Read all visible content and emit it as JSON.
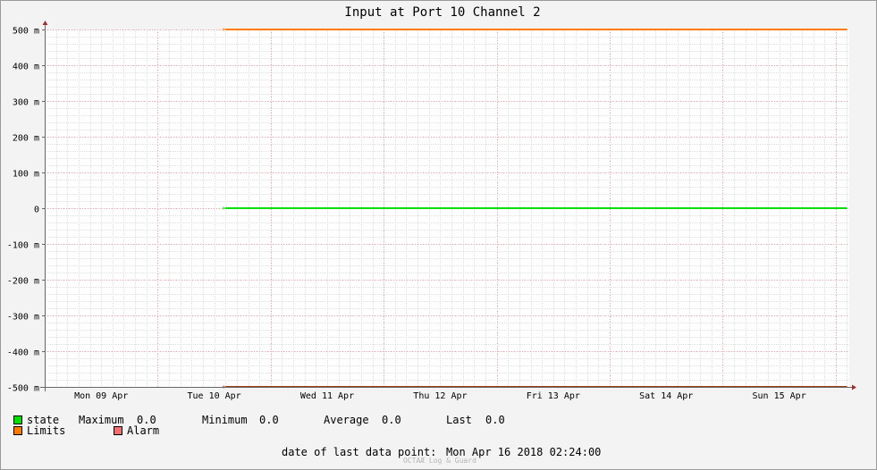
{
  "chart_data": {
    "type": "line",
    "title": "Input at Port 10 Channel 2",
    "ylim": [
      -500,
      500
    ],
    "y_ticks": [
      {
        "value": 500,
        "label": "500 m"
      },
      {
        "value": 400,
        "label": "400 m"
      },
      {
        "value": 300,
        "label": "300 m"
      },
      {
        "value": 200,
        "label": "200 m"
      },
      {
        "value": 100,
        "label": "100 m"
      },
      {
        "value": 0,
        "label": "0"
      },
      {
        "value": -100,
        "label": "-100 m"
      },
      {
        "value": -200,
        "label": "-200 m"
      },
      {
        "value": -300,
        "label": "-300 m"
      },
      {
        "value": -400,
        "label": "-400 m"
      },
      {
        "value": -500,
        "label": "-500 m"
      }
    ],
    "x_range_days": [
      0,
      7.12
    ],
    "x_ticks": [
      {
        "day": 0.5,
        "label": "Mon 09 Apr"
      },
      {
        "day": 1.5,
        "label": "Tue 10 Apr"
      },
      {
        "day": 2.5,
        "label": "Wed 11 Apr"
      },
      {
        "day": 3.5,
        "label": "Thu 12 Apr"
      },
      {
        "day": 4.5,
        "label": "Fri 13 Apr"
      },
      {
        "day": 5.5,
        "label": "Sat 14 Apr"
      },
      {
        "day": 6.5,
        "label": "Sun 15 Apr"
      }
    ],
    "series": [
      {
        "name": "state",
        "color": "#00e000",
        "x_start": 1.6,
        "x_end": 7.1,
        "y": [
          0,
          0
        ]
      },
      {
        "name": "Limits",
        "color": "#ff7a00",
        "x_start": 1.6,
        "x_end": 7.1,
        "y": [
          500,
          500
        ]
      },
      {
        "name": "Limits",
        "color": "#a03c10",
        "x_start": 1.6,
        "x_end": 7.1,
        "y": [
          -500,
          -500
        ]
      }
    ],
    "grid": true
  },
  "legend": {
    "state": {
      "label": "state",
      "color": "#00e000"
    },
    "limits": {
      "label": "Limits",
      "color": "#ff7a00"
    },
    "alarm": {
      "label": "Alarm",
      "color": "#f07070"
    },
    "stats": {
      "maximum_label": "Maximum",
      "maximum_value": "0.0",
      "minimum_label": "Minimum",
      "minimum_value": "0.0",
      "average_label": "Average",
      "average_value": "0.0",
      "last_label": "Last",
      "last_value": "0.0"
    }
  },
  "footer": {
    "last_point_label": "date of last data point:",
    "last_point_value": "Mon Apr 16 2018 02:24:00",
    "watermark": "OCTAÆ Log & Guard"
  }
}
